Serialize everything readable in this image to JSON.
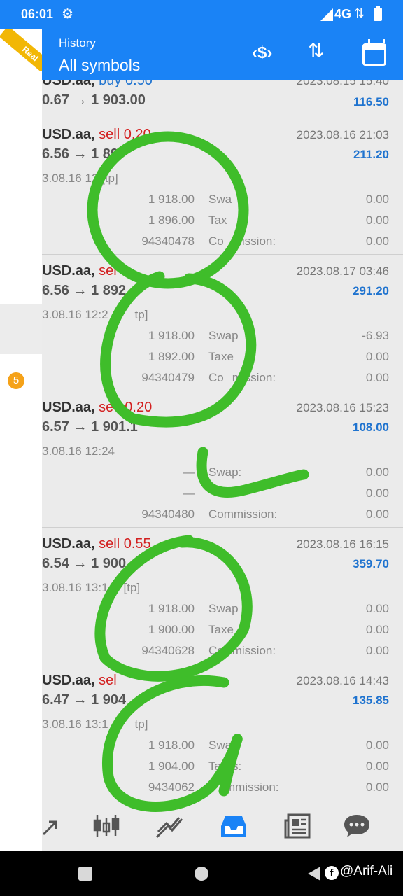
{
  "status_bar": {
    "time": "06:01",
    "network": "4G"
  },
  "header": {
    "title": "History",
    "subtitle": "All symbols"
  },
  "account_badge": "Real",
  "drawer": {
    "badge_count": "5"
  },
  "deals": [
    {
      "symbol": "USD.aa,",
      "type": "buy",
      "volume": "buy 0.50",
      "prices": "0.67 → 1 903.00",
      "date": "2023.08.15 15:40",
      "profit": "116.50"
    },
    {
      "symbol": "USD.aa,",
      "type": "sell",
      "volume": "sell 0.20",
      "prices": "6.56 → 1 89",
      "date": "2023.08.16 21:03",
      "profit": "211.20",
      "opened": "3.08.16 12",
      "tag": "[tp]",
      "sl": "1 918.00",
      "tp": "1 896.00",
      "ticket": "94340478",
      "swap_label": "Swa",
      "swap": "0.00",
      "taxes_label": "Tax",
      "taxes": "0.00",
      "commission_label": "Co",
      "commission_label2": "mission:",
      "commission": "0.00"
    },
    {
      "symbol": "USD.aa,",
      "type": "sell",
      "volume": "sel",
      "prices": "6.56 → 1 892",
      "date": "2023.08.17 03:46",
      "profit": "291.20",
      "opened": "3.08.16 12:2",
      "tag": "tp]",
      "sl": "1 918.00",
      "tp": "1 892.00",
      "ticket": "94340479",
      "swap_label": "Swap",
      "swap": "-6.93",
      "taxes_label": "Taxe",
      "taxes": "0.00",
      "commission_label": "Co",
      "commission_label2": "mission:",
      "commission": "0.00"
    },
    {
      "symbol": "USD.aa,",
      "type": "sell",
      "volume": "se",
      "volume2": "0.20",
      "prices": "6.57 → 1 901.1",
      "date": "2023.08.16 15:23",
      "profit": "108.00",
      "opened": "3.08.16 12:24",
      "tag": "",
      "sl": "—",
      "tp": "—",
      "ticket": "94340480",
      "swap_label": "Swap:",
      "swap": "0.00",
      "taxes_label": "",
      "taxes": "0.00",
      "commission_label": "Commission:",
      "commission_label2": "",
      "commission": "0.00"
    },
    {
      "symbol": "USD.aa,",
      "type": "sell",
      "volume": "sell 0.55",
      "prices": "6.54 → 1 900",
      "date": "2023.08.16 16:15",
      "profit": "359.70",
      "opened": "3.08.16 13:1",
      "tag": "[tp]",
      "sl": "1 918.00",
      "tp": "1 900.00",
      "ticket": "94340628",
      "swap_label": "Swap",
      "swap": "0.00",
      "taxes_label": "Taxe",
      "taxes": "0.00",
      "commission_label": "Co",
      "commission_label2": "mission:",
      "commission": "0.00"
    },
    {
      "symbol": "USD.aa,",
      "type": "sell",
      "volume": "sel",
      "prices": "6.47 → 1 904",
      "date": "2023.08.16 14:43",
      "profit": "135.85",
      "opened": "3.08.16 13:1",
      "tag": "tp]",
      "sl": "1 918.00",
      "tp": "1 904.00",
      "ticket": "9434062",
      "swap_label": "Swa",
      "swap": "0.00",
      "taxes_label": "Ta",
      "taxes_label2": "s:",
      "taxes": "0.00",
      "commission_label": "",
      "commission_label2": "mmission:",
      "commission": "0.00"
    }
  ],
  "watermark": "@Arif-Ali",
  "colors": {
    "accent": "#1a83f6",
    "buy": "#1f73cf",
    "sell": "#d32020",
    "scribble": "#3fbd2a",
    "badge": "#f5a219"
  },
  "bottom_nav": [
    "trade-icon",
    "chart-icon",
    "analytics-icon",
    "history-icon",
    "news-icon",
    "chat-icon"
  ]
}
